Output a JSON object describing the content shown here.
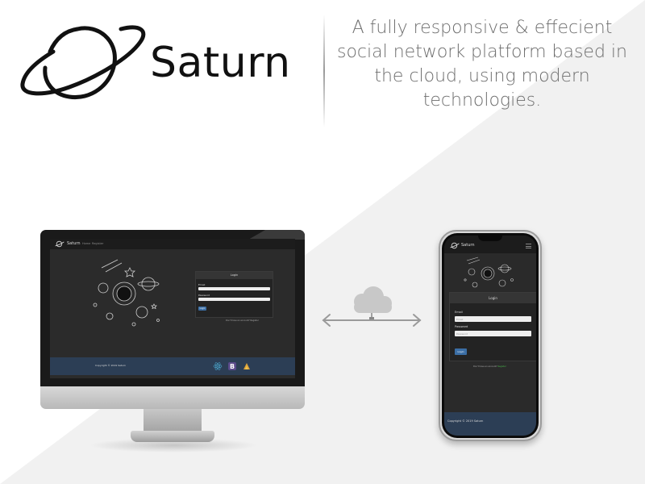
{
  "brand": {
    "name": "Saturn",
    "logo_icon": "saturn-planet-icon"
  },
  "tagline": "A fully responsive & effecient social network platform based in the cloud, using modern technologies.",
  "colors": {
    "background_light": "#f1f1f1",
    "app_dark": "#2b2b2b",
    "footer_blue": "#2c3e55",
    "button_blue": "#3b6ea5",
    "link_green": "#49b84b"
  },
  "desktop": {
    "nav": {
      "brand": "Saturn",
      "links": [
        "Home",
        "Register"
      ]
    },
    "login": {
      "title": "Login",
      "email_label": "Email",
      "email_placeholder": "Email",
      "password_label": "Password",
      "password_placeholder": "Password",
      "button_label": "Login",
      "register_prompt": "Don't have an account? Register"
    },
    "footer": {
      "copyright": "Copyright © 2019 Saturn",
      "tech_icons": [
        "react-icon",
        "bootstrap-icon",
        "firebase-icon"
      ]
    }
  },
  "cloud": {
    "icon": "cloud-icon",
    "arrow": "double-arrow-icon"
  },
  "mobile": {
    "nav": {
      "brand": "Saturn",
      "menu_icon": "hamburger-icon"
    },
    "login": {
      "title": "Login",
      "email_label": "Email",
      "email_placeholder": "Email",
      "password_label": "Password",
      "password_placeholder": "Password",
      "button_label": "Login",
      "register_prompt": "Don't have an account?",
      "register_link": "Register"
    },
    "footer": {
      "copyright": "Copyright © 2019 Saturn"
    }
  }
}
